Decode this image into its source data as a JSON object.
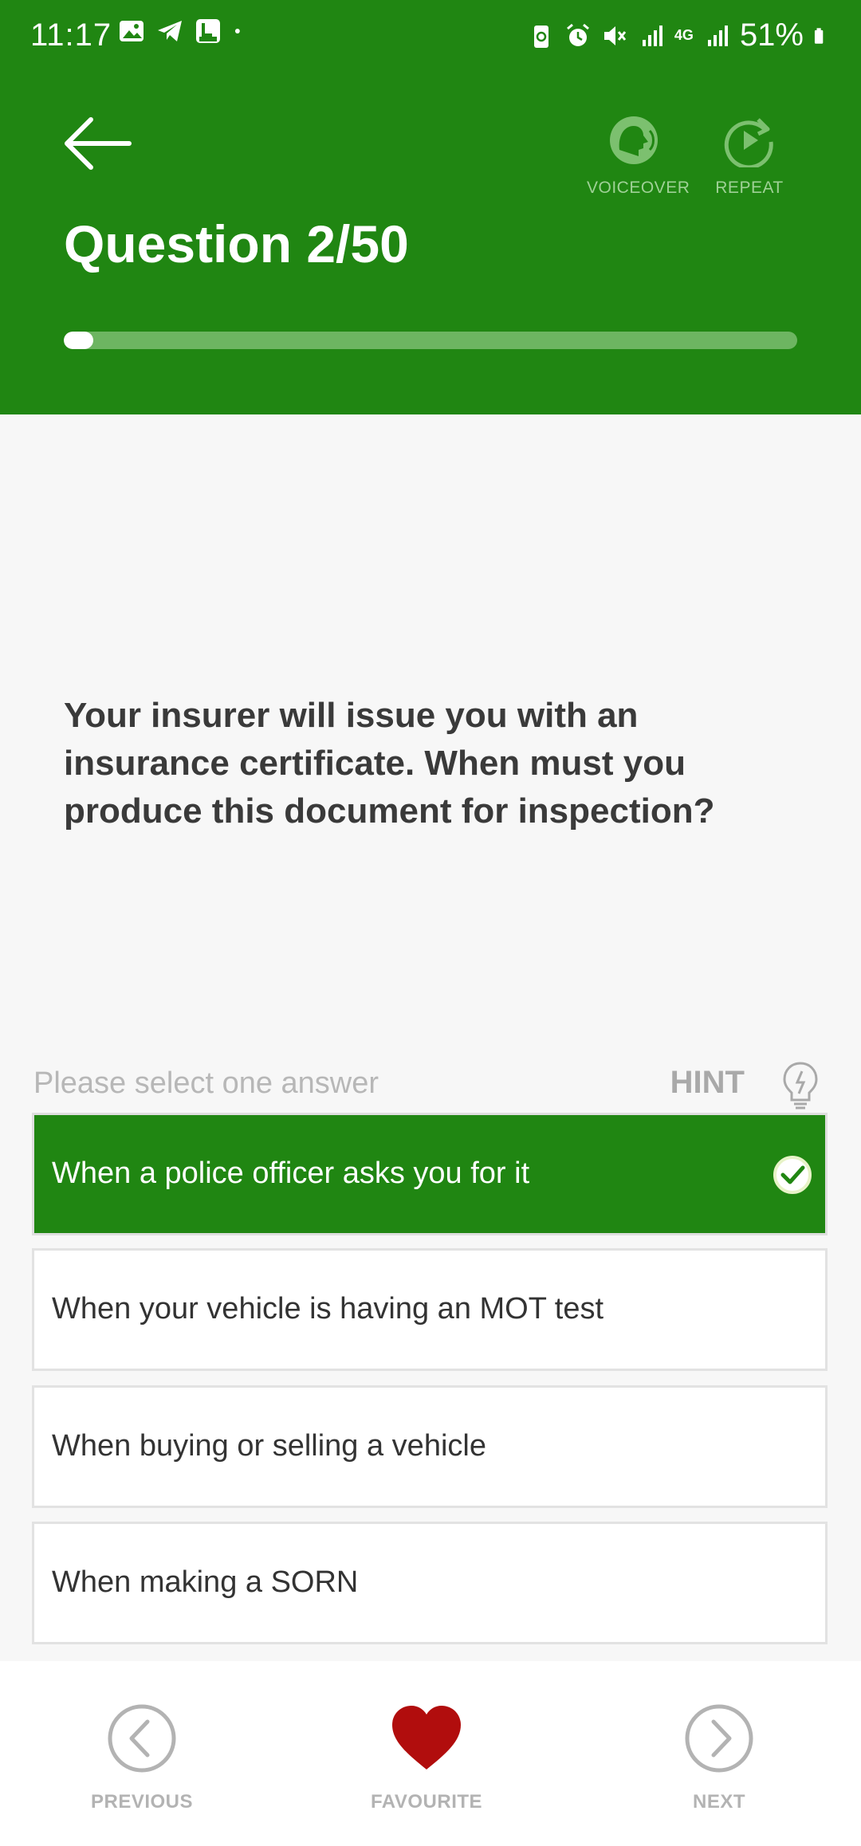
{
  "status_bar": {
    "time": "11:17",
    "network": "4G",
    "battery": "51%",
    "left_icons": [
      "gallery-icon",
      "telegram-icon",
      "app-4in1-icon",
      "dot-icon"
    ],
    "right_icons": [
      "battery-saver-icon",
      "alarm-icon",
      "mute-icon",
      "signal-icon",
      "signal-icon"
    ]
  },
  "header": {
    "title": "Question 2/50",
    "voiceover_label": "VOICEOVER",
    "repeat_label": "REPEAT",
    "progress": 0.04,
    "colors": {
      "background": "#208612",
      "progress_track": "#6db561",
      "progress_fill": "#ffffff"
    }
  },
  "question": {
    "text": "Your insurer will issue you with an insurance certificate. When must you produce this document for inspection?"
  },
  "answers_section": {
    "prompt": "Please select one answer",
    "hint_label": "HINT"
  },
  "answers": [
    {
      "label": "When a police officer asks you for it",
      "selected": true
    },
    {
      "label": "When your vehicle is having an MOT test",
      "selected": false
    },
    {
      "label": "When buying or selling a vehicle",
      "selected": false
    },
    {
      "label": "When making a SORN",
      "selected": false
    }
  ],
  "bottom_nav": {
    "previous_label": "PREVIOUS",
    "favourite_label": "FAVOURITE",
    "next_label": "NEXT",
    "colors": {
      "heart": "#b10d0d",
      "icons": "#b3b3b3"
    }
  }
}
